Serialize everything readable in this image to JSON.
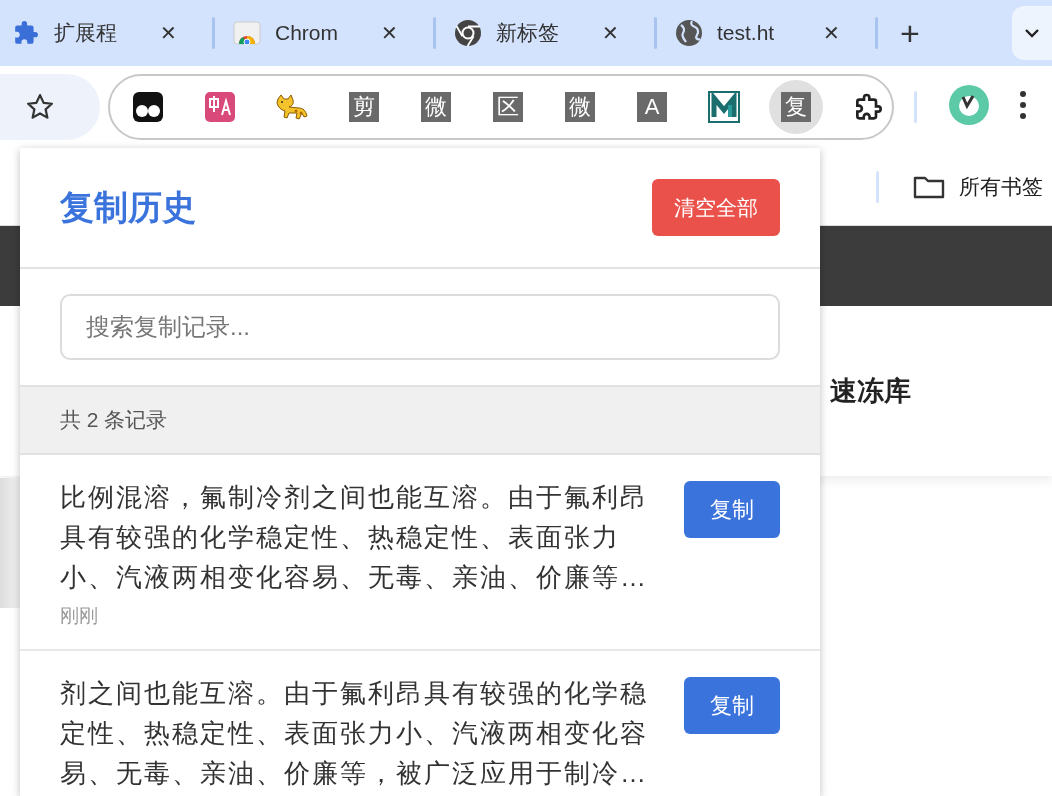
{
  "tabs": [
    {
      "title": "扩展程",
      "kind": "puzzle",
      "close": "✕",
      "selected": false
    },
    {
      "title": "Chrom",
      "kind": "store",
      "close": "✕",
      "selected": false
    },
    {
      "title": "新标签",
      "kind": "chrome",
      "close": "✕",
      "selected": false
    },
    {
      "title": "test.ht",
      "kind": "globe",
      "close": "✕",
      "selected": false
    }
  ],
  "new_tab": "+",
  "extensions": [
    {
      "kind": "dots",
      "active": false
    },
    {
      "kind": "translate",
      "active": false
    },
    {
      "kind": "cat",
      "active": false
    },
    {
      "kind": "glyph",
      "label": "剪",
      "active": false
    },
    {
      "kind": "glyph",
      "label": "微",
      "active": false
    },
    {
      "kind": "glyph",
      "label": "区",
      "active": false
    },
    {
      "kind": "glyph",
      "label": "微",
      "active": false
    },
    {
      "kind": "glyph",
      "label": "A",
      "active": false
    },
    {
      "kind": "mlogo",
      "active": false
    },
    {
      "kind": "glyph",
      "label": "复",
      "active": true
    },
    {
      "kind": "puzzle",
      "active": false
    }
  ],
  "bookmarks_bar": {
    "folder": "所有书签"
  },
  "page": {
    "right_text": "速冻库"
  },
  "popup": {
    "title": "复制历史",
    "clear_button": "清空全部",
    "search": {
      "placeholder": "搜索复制记录..."
    },
    "count": "共 2 条记录",
    "items": [
      {
        "text": "比例混溶，氟制冷剂之间也能互溶。由于氟利昂具有较强的化学稳定性、热稳定性、表面张力小、汽液两相变化容易、无毒、亲油、价廉等…",
        "time": "刚刚",
        "button": "复制"
      },
      {
        "text": "剂之间也能互溶。由于氟利昂具有较强的化学稳定性、热稳定性、表面张力小、汽液两相变化容易、无毒、亲油、价廉等，被广泛应用于制冷…",
        "button": "复制"
      }
    ]
  }
}
